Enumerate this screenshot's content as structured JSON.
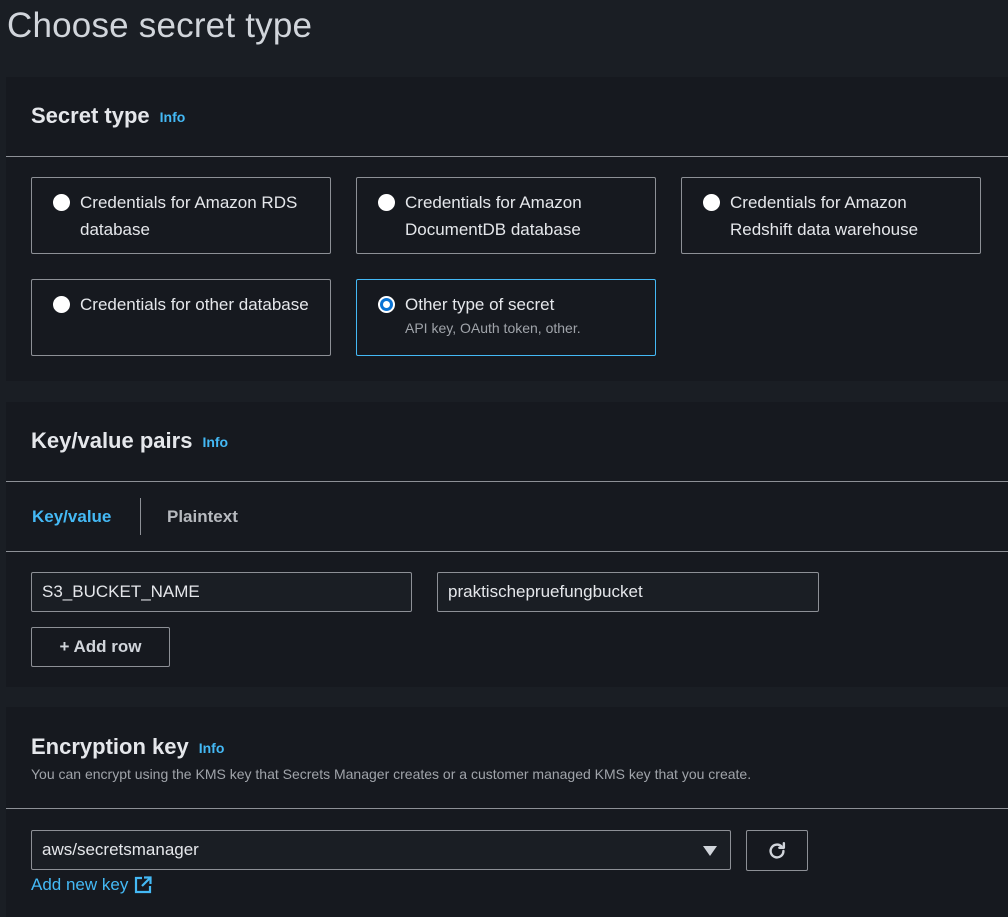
{
  "page": {
    "title": "Choose secret type"
  },
  "secret_type": {
    "title": "Secret type",
    "info": "Info",
    "options": [
      {
        "label": "Credentials for Amazon RDS database",
        "description": "",
        "selected": false
      },
      {
        "label": "Credentials for Amazon DocumentDB database",
        "description": "",
        "selected": false
      },
      {
        "label": "Credentials for Amazon Redshift data warehouse",
        "description": "",
        "selected": false
      },
      {
        "label": "Credentials for other database",
        "description": "",
        "selected": false
      },
      {
        "label": "Other type of secret",
        "description": "API key, OAuth token, other.",
        "selected": true
      }
    ]
  },
  "kv": {
    "title": "Key/value pairs",
    "info": "Info",
    "tabs": [
      "Key/value",
      "Plaintext"
    ],
    "active_tab": "Key/value",
    "rows": [
      {
        "key": "S3_BUCKET_NAME",
        "value": "praktischepruefungbucket"
      }
    ],
    "add_row_label": "+ Add row"
  },
  "encryption": {
    "title": "Encryption key",
    "info": "Info",
    "description": "You can encrypt using the KMS key that Secrets Manager creates or a customer managed KMS key that you create.",
    "selected_key": "aws/secretsmanager",
    "add_key_label": "Add new key",
    "refresh_icon": "refresh-icon",
    "external_icon": "external-link-icon"
  },
  "colors": {
    "accent": "#44b9f5",
    "radio_selected": "#0972d3",
    "background": "#1a1e24",
    "panel": "#16191f",
    "border": "#8d9096"
  }
}
